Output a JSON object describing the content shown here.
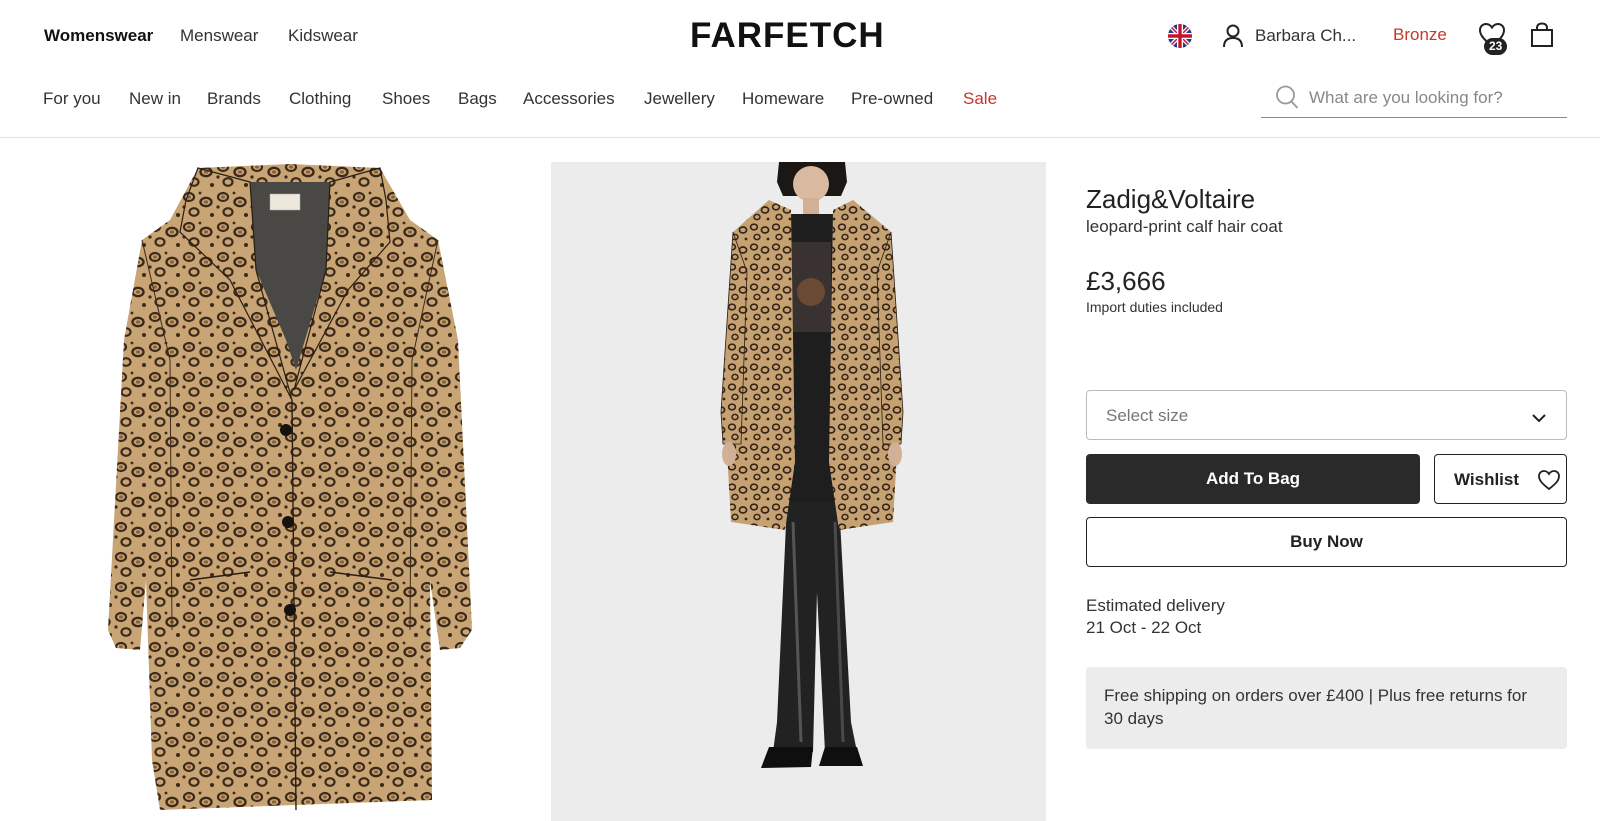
{
  "header": {
    "departments": [
      "Womenswear",
      "Menswear",
      "Kidswear"
    ],
    "logo": "FARFETCH",
    "user_name": "Barbara Ch...",
    "loyalty_tier": "Bronze",
    "wishlist_count": "23",
    "icons": [
      "uk-flag-icon",
      "user-icon",
      "heart-icon",
      "shopping-bag-icon"
    ]
  },
  "nav": {
    "categories": [
      "For you",
      "New in",
      "Brands",
      "Clothing",
      "Shoes",
      "Bags",
      "Accessories",
      "Jewellery",
      "Homeware",
      "Pre-owned",
      "Sale"
    ],
    "search_placeholder": "What are you looking for?"
  },
  "product": {
    "brand": "Zadig&Voltaire",
    "name": "leopard-print calf hair coat",
    "price": "£3,666",
    "duties_note": "Import duties included",
    "size_placeholder": "Select size",
    "add_to_bag": "Add To Bag",
    "wishlist": "Wishlist",
    "buy_now": "Buy Now",
    "delivery_label": "Estimated delivery",
    "delivery_dates": "21 Oct - 22 Oct",
    "shipping_note": "Free shipping on orders over £400 | Plus free returns for 30 days"
  },
  "colors": {
    "sale_red": "#c8372d",
    "button_dark": "#2a2a2a",
    "panel_grey": "#ececec",
    "leopard_base": "#c9a474",
    "leopard_spot": "#3a2a1c"
  }
}
